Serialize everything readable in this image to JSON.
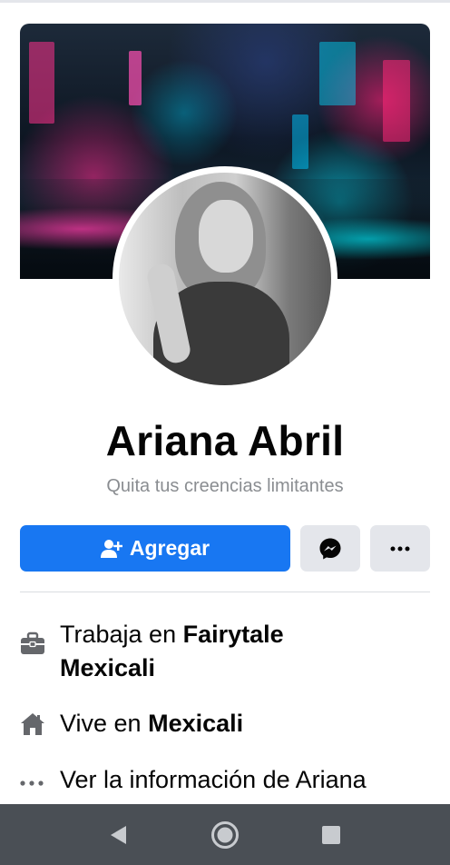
{
  "profile": {
    "name": "Ariana Abril",
    "bio": "Quita tus creencias limitantes"
  },
  "actions": {
    "add_label": "Agregar",
    "add_icon": "add-friend-icon",
    "message_icon": "messenger-icon",
    "more_icon": "more-dots-icon"
  },
  "info": {
    "work_prefix": "Trabaja en ",
    "work_place_line1": "Fairytale",
    "work_place_line2": "Mexicali",
    "work_icon": "briefcase-icon",
    "lives_prefix": "Vive en ",
    "lives_place": "Mexicali",
    "lives_icon": "home-icon",
    "about_label": "Ver la información de Ariana",
    "about_icon": "more-dots-icon"
  },
  "navbar": {
    "back_icon": "back-triangle-icon",
    "home_icon": "home-circle-icon",
    "recents_icon": "recents-square-icon"
  },
  "colors": {
    "accent": "#1877f2",
    "secondary_button": "#e4e6eb",
    "muted_text": "#8a8d91",
    "navbar": "#4a4f55"
  }
}
